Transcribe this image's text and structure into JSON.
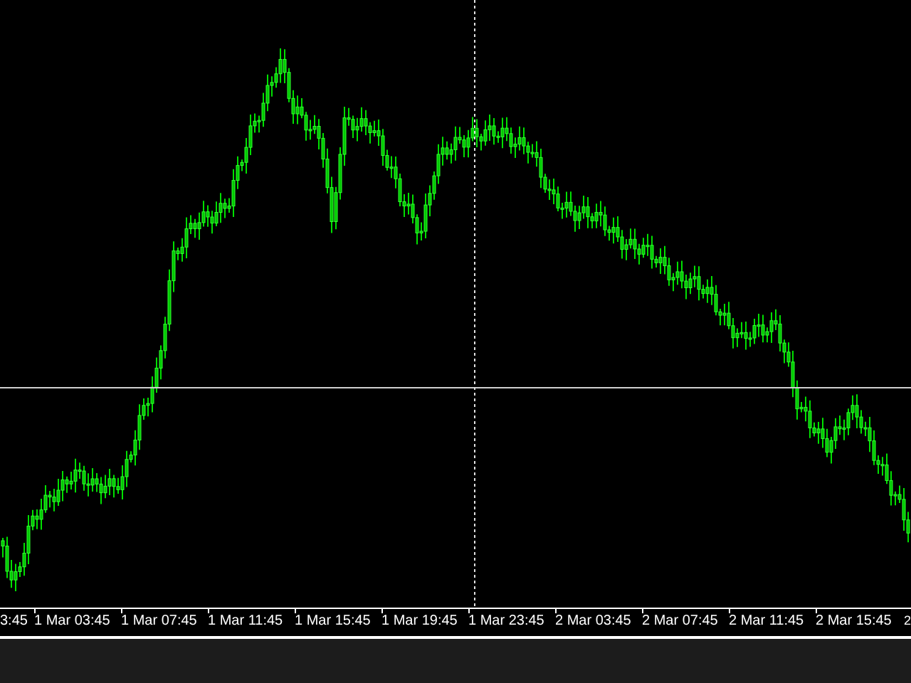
{
  "time_axis": {
    "labels": [
      "3:45",
      "1 Mar 03:45",
      "1 Mar 07:45",
      "1 Mar 11:45",
      "1 Mar 15:45",
      "1 Mar 19:45",
      "1 Mar 23:45",
      "2 Mar 03:45",
      "2 Mar 07:45",
      "2 Mar 11:45",
      "2 Mar 15:45",
      "2"
    ]
  }
}
